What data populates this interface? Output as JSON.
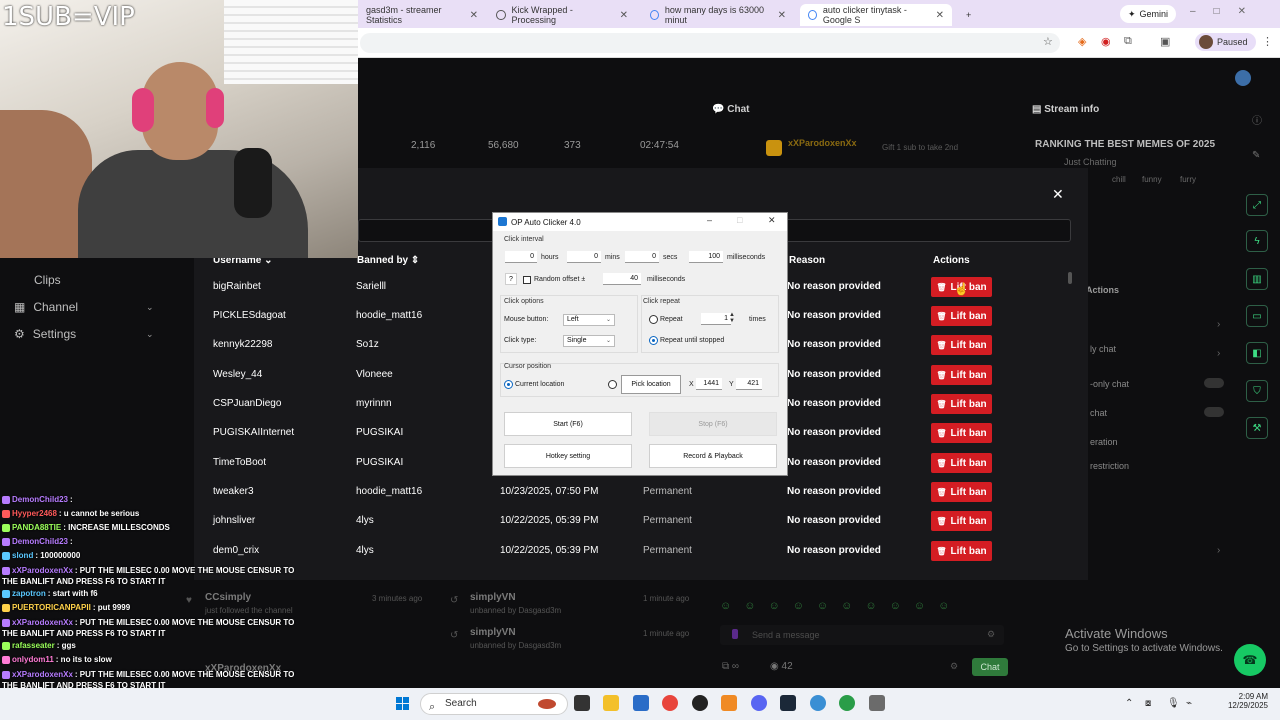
{
  "browser": {
    "tabs": [
      {
        "label": "gasd3m - streamer Statistics"
      },
      {
        "label": "Kick Wrapped - Processing"
      },
      {
        "label": "how many days is 63000 minut"
      },
      {
        "label": "auto clicker tinytask - Google S"
      }
    ],
    "new_tab": "+",
    "gemini_label": "Gemini",
    "profile_status": "Paused"
  },
  "overlay": {
    "sub_text": "1SUB=VIP"
  },
  "dashboard": {
    "panels": {
      "chat_title": "Chat",
      "stream_info_title": "Stream info"
    },
    "stats": [
      "2,116",
      "56,680",
      "373",
      "02:47:54"
    ],
    "chat_top_user": "xXParodoxenXx",
    "chat_top_note": "Gift 1 sub to take 2nd",
    "stream_title": "RANKING THE BEST MEMES OF 2025",
    "stream_category": "Just Chatting",
    "stream_tags": [
      "chill",
      "funny",
      "furry"
    ],
    "side_nav": [
      {
        "label": "Clips"
      },
      {
        "label": "Channel"
      },
      {
        "label": "Settings"
      }
    ],
    "actions_panel": {
      "title": "Actions",
      "items": [
        "ly chat",
        "-only chat",
        "chat",
        "eration",
        "restriction"
      ]
    }
  },
  "ban_table": {
    "headers": {
      "username": "Username",
      "banned_by": "Banned by",
      "reason": "Reason",
      "actions": "Actions"
    },
    "lift_label": "Lift ban",
    "rows": [
      {
        "username": "bigRainbet",
        "banned_by": "Sarielll",
        "date": "",
        "duration": "",
        "reason": "No reason provided"
      },
      {
        "username": "PICKLESdagoat",
        "banned_by": "hoodie_matt16",
        "date": "",
        "duration": "",
        "reason": "No reason provided"
      },
      {
        "username": "kennyk22298",
        "banned_by": "So1z",
        "date": "",
        "duration": "",
        "reason": "No reason provided"
      },
      {
        "username": "Wesley_44",
        "banned_by": "Vloneee",
        "date": "",
        "duration": "",
        "reason": "No reason provided"
      },
      {
        "username": "CSPJuanDiego",
        "banned_by": "myrinnn",
        "date": "",
        "duration": "",
        "reason": "No reason provided"
      },
      {
        "username": "PUGISKAIInternet",
        "banned_by": "PUGSIKAI",
        "date": "",
        "duration": "",
        "reason": "No reason provided"
      },
      {
        "username": "TimeToBoot",
        "banned_by": "PUGSIKAI",
        "date": "",
        "duration": "",
        "reason": "No reason provided"
      },
      {
        "username": "tweaker3",
        "banned_by": "hoodie_matt16",
        "date": "10/23/2025, 07:50 PM",
        "duration": "Permanent",
        "reason": "No reason provided"
      },
      {
        "username": "johnsliver",
        "banned_by": "4lys",
        "date": "10/22/2025, 05:39 PM",
        "duration": "Permanent",
        "reason": "No reason provided"
      },
      {
        "username": "dem0_crix",
        "banned_by": "4lys",
        "date": "10/22/2025, 05:39 PM",
        "duration": "Permanent",
        "reason": "No reason provided"
      }
    ]
  },
  "auto_clicker": {
    "title": "OP Auto Clicker 4.0",
    "click_interval_label": "Click interval",
    "hours": {
      "value": "0",
      "unit": "hours"
    },
    "mins": {
      "value": "0",
      "unit": "mins"
    },
    "secs": {
      "value": "0",
      "unit": "secs"
    },
    "ms": {
      "value": "100",
      "unit": "milliseconds"
    },
    "help": "?",
    "random_offset_label": "Random offset ±",
    "random_offset_value": "40",
    "random_offset_unit": "milliseconds",
    "click_options_label": "Click options",
    "mouse_button_label": "Mouse button:",
    "mouse_button_value": "Left",
    "click_type_label": "Click type:",
    "click_type_value": "Single",
    "click_repeat_label": "Click repeat",
    "repeat_label": "Repeat",
    "repeat_value": "1",
    "repeat_unit": "times",
    "repeat_until_stopped_label": "Repeat until stopped",
    "cursor_position_label": "Cursor position",
    "current_location_label": "Current location",
    "pick_location_label": "Pick location",
    "x_label": "X",
    "x_value": "1441",
    "y_label": "Y",
    "y_value": "421",
    "start_label": "Start (F6)",
    "stop_label": "Stop (F6)",
    "hotkey_label": "Hotkey setting",
    "record_label": "Record & Playback"
  },
  "chat_overlay": [
    {
      "user": "DemonChild23",
      "text": ":",
      "color": "#b77cff"
    },
    {
      "user": "Hyyper2468",
      "text": ": u cannot be serious",
      "color": "#ff5a5a"
    },
    {
      "user": "PANDA88TIE",
      "text": ": INCREASE MILLESCONDS",
      "color": "#9bff5a"
    },
    {
      "user": "DemonChild23",
      "text": ":",
      "color": "#b77cff"
    },
    {
      "user": "slond",
      "text": ": 100000000",
      "color": "#5ac8ff"
    },
    {
      "user": "xXParodoxenXx",
      "text": ": PUT THE MILESEC 0.00 MOVE THE MOUSE CENSUR TO THE BANLIFT AND PRESS F6 TO START IT",
      "color": "#b77cff"
    },
    {
      "user": "zapotron",
      "text": ": start with f6",
      "color": "#5ac8ff"
    },
    {
      "user": "PUERTORICANPAPII",
      "text": ": put 9999",
      "color": "#ffd24a"
    },
    {
      "user": "xXParodoxenXx",
      "text": ": PUT THE MILESEC 0.00 MOVE THE MOUSE CENSUR TO THE BANLIFT AND PRESS F6 TO START IT",
      "color": "#b77cff"
    },
    {
      "user": "rafasseater",
      "text": ": ggs",
      "color": "#9bff5a"
    },
    {
      "user": "onlydom11",
      "text": ": no its to slow",
      "color": "#ff7bd5"
    },
    {
      "user": "xXParodoxenXx",
      "text": ": PUT THE MILESEC 0.00 MOVE THE MOUSE CENSUR TO THE BANLIFT AND PRESS F6 TO START IT",
      "color": "#b77cff"
    }
  ],
  "activity": [
    {
      "user": "CCsimply",
      "note": "just followed the channel",
      "time": "3 minutes ago"
    },
    {
      "user": "simplyVN",
      "note": "unbanned by Dasgasd3m",
      "time": "1 minute ago"
    },
    {
      "user": "simplyVN",
      "note": "unbanned by Dasgasd3m",
      "time": "1 minute ago"
    },
    {
      "user": "xXParodoxenXx",
      "note": "",
      "time": ""
    }
  ],
  "chat_input": {
    "placeholder": "Send a message",
    "count": "42",
    "send_label": "Chat"
  },
  "activate_windows": {
    "line1": "Activate Windows",
    "line2": "Go to Settings to activate Windows."
  },
  "taskbar": {
    "search_label": "Search",
    "time": "2:09 AM",
    "date": "12/29/2025"
  }
}
